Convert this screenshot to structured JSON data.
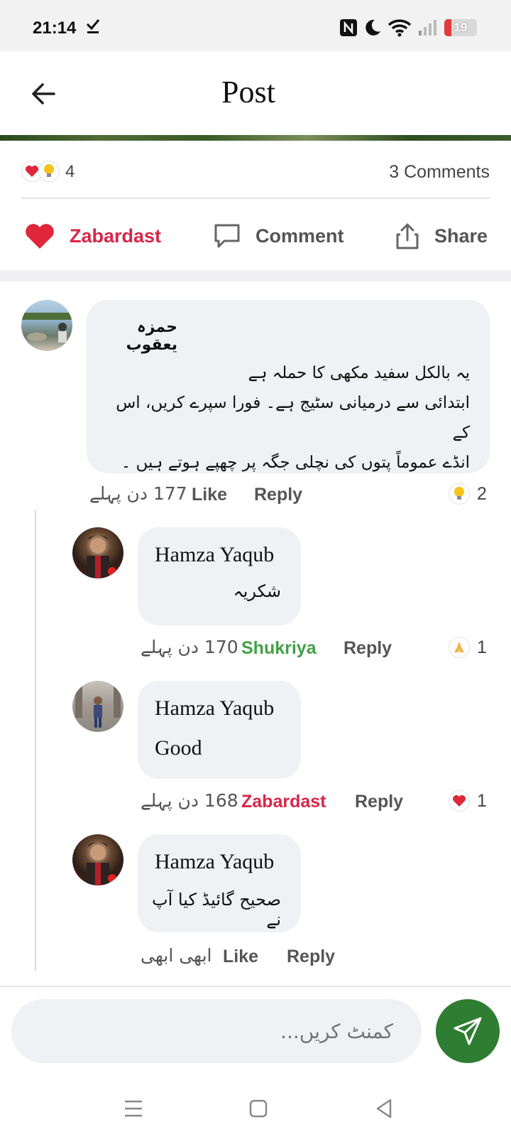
{
  "status": {
    "time": "21:14",
    "battery": "19",
    "icons": [
      "download-done-icon",
      "nfc-icon",
      "do-not-disturb-moon-icon",
      "wifi-icon",
      "signal-icon",
      "battery-icon"
    ]
  },
  "header": {
    "title": "Post"
  },
  "summary": {
    "reaction_count": "4",
    "comments": "3 Comments"
  },
  "actions": {
    "zabardast": "Zabardast",
    "comment": "Comment",
    "share": "Share"
  },
  "comments": [
    {
      "author": "حمزہ یعقوب",
      "lines": [
        "یہ بالکل سفید مکھی کا حملہ ہے",
        "ابتدائی سے درمیانی سٹیج ہے۔ فورا سپرے کریں، اس کے",
        "انڈے عموماً پتوں کی نچلی جگہ پر چھپے ہوتے ہیں ۔"
      ],
      "time": "177 دن پہلے",
      "reaction_label": "Like",
      "reply": "Reply",
      "reaction_count": "2"
    },
    {
      "author": "Hamza Yaqub",
      "text": "شکریہ",
      "time": "170 دن پہلے",
      "reaction_label": "Shukriya",
      "reply": "Reply",
      "reaction_count": "1"
    },
    {
      "author": "Hamza Yaqub",
      "text": "Good",
      "time": "168 دن پہلے",
      "reaction_label": "Zabardast",
      "reply": "Reply",
      "reaction_count": "1"
    },
    {
      "author": "Hamza Yaqub",
      "text": "صحیح گائیڈ کیا آپ نے",
      "time": "ابھی ابھی",
      "reaction_label": "Like",
      "reply": "Reply"
    }
  ],
  "composer": {
    "placeholder": "کمنٹ کریں..."
  },
  "colors": {
    "accent_green": "#2e7d32",
    "zabardast_red": "#d7264a",
    "shukriya_green": "#43a047",
    "bubble_bg": "#f0f1f5"
  }
}
